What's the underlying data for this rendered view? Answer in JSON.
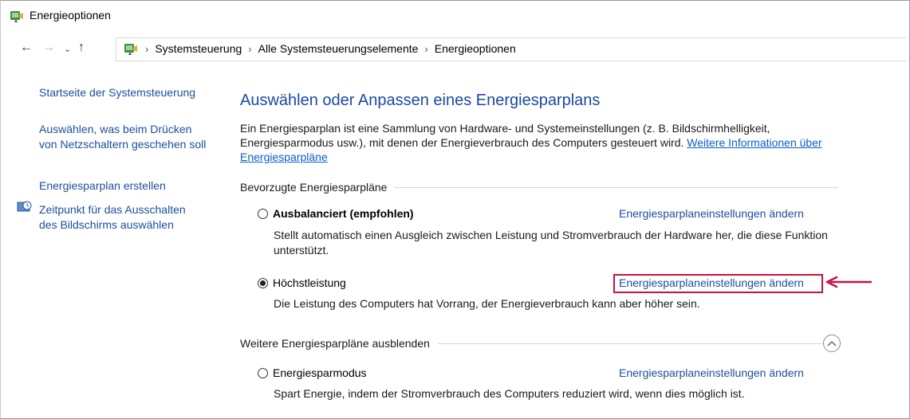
{
  "window": {
    "title": "Energieoptionen"
  },
  "nav": {
    "back_icon": "arrow-left-icon",
    "forward_icon": "arrow-right-icon",
    "recent_icon": "chevron-down-icon",
    "up_icon": "arrow-up-icon",
    "breadcrumbs": [
      "Systemsteuerung",
      "Alle Systemsteuerungselemente",
      "Energieoptionen"
    ],
    "separator": "›"
  },
  "sidebar": {
    "home": "Startseite der Systemsteuerung",
    "power_buttons": "Auswählen, was beim Drücken von Netzschaltern geschehen soll",
    "create_plan": "Energiesparplan erstellen",
    "screen_off": "Zeitpunkt für das Ausschalten des Bildschirms auswählen"
  },
  "main": {
    "title": "Auswählen oder Anpassen eines Energiesparplans",
    "intro_text": "Ein Energiesparplan ist eine Sammlung von Hardware- und Systemeinstellungen (z. B. Bildschirmhelligkeit, Energiesparmodus usw.), mit denen der Energieverbrauch des Computers gesteuert wird. ",
    "intro_link": "Weitere Informationen über Energiesparpläne",
    "preferred_heading": "Bevorzugte Energiesparpläne",
    "more_heading": "Weitere Energiesparpläne ausblenden",
    "plans": [
      {
        "name": "Ausbalanciert (empfohlen)",
        "selected": false,
        "description": "Stellt automatisch einen Ausgleich zwischen Leistung und Stromverbrauch der Hardware her, die diese Funktion unterstützt.",
        "link": "Energiesparplaneinstellungen ändern"
      },
      {
        "name": "Höchstleistung",
        "selected": true,
        "description": "Die Leistung des Computers hat Vorrang, der Energieverbrauch kann aber höher sein.",
        "link": "Energiesparplaneinstellungen ändern"
      },
      {
        "name": "Energiesparmodus",
        "selected": false,
        "description": "Spart Energie, indem der Stromverbrauch des Computers reduziert wird, wenn dies möglich ist.",
        "link": "Energiesparplaneinstellungen ändern"
      }
    ]
  },
  "colors": {
    "link": "#1b4f9c",
    "title": "#1b4aa0",
    "highlight": "#c8133f"
  }
}
